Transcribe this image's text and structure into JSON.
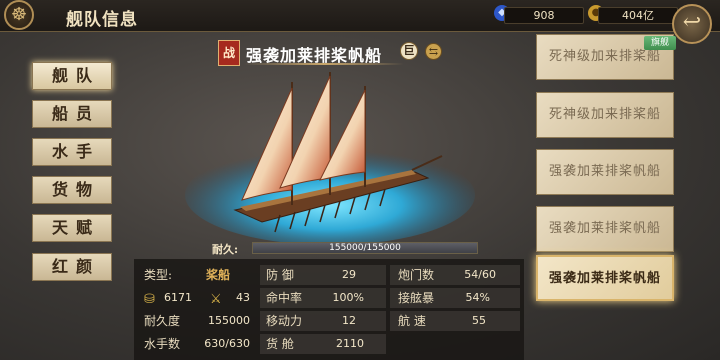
{
  "header": {
    "menu_icon": "compass-wheel-icon",
    "title": "舰队信息",
    "gems": "908",
    "gold": "404亿",
    "gem_icon": "blue-gem-icon",
    "coin_icon": "gold-coin-icon",
    "back_icon": "back-arrow-icon"
  },
  "sidebar": {
    "items": [
      {
        "label": "舰队",
        "active": true
      },
      {
        "label": "船员",
        "active": false
      },
      {
        "label": "水手",
        "active": false
      },
      {
        "label": "货物",
        "active": false
      },
      {
        "label": "天赋",
        "active": false
      },
      {
        "label": "红颜",
        "active": false
      }
    ]
  },
  "ship": {
    "battle_badge": "战",
    "name": "强袭加莱排桨帆船",
    "size_badge": "巨",
    "durability_label": "耐久:",
    "durability_text": "155000/155000",
    "durability_fraction": 1.0
  },
  "stats": {
    "type_label": "类型:",
    "type_value": "桨船",
    "food_value": "6171",
    "soldier_value": "43",
    "durability_label": "耐久度",
    "durability_value": "155000",
    "sailors_label": "水手数",
    "sailors_value": "630/630",
    "defense_label": "防  御",
    "defense_value": "29",
    "accuracy_label": "命中率",
    "accuracy_value": "100%",
    "mobility_label": "移动力",
    "mobility_value": "12",
    "cargo_label": "货  舱",
    "cargo_value": "2110",
    "cannon_label": "炮门数",
    "cannon_value": "54/60",
    "boarding_label": "接舷暴",
    "boarding_value": "54%",
    "speed_label": "航  速",
    "speed_value": "55"
  },
  "fleet_list": {
    "flagship_tag": "旗舰",
    "ships": [
      {
        "name": "死神级加来排桨船",
        "selected": false
      },
      {
        "name": "死神级加来排桨船",
        "selected": false
      },
      {
        "name": "强袭加莱排桨帆船",
        "selected": false
      },
      {
        "name": "强袭加莱排桨帆船",
        "selected": false
      },
      {
        "name": "强袭加莱排桨帆船",
        "selected": true
      }
    ]
  }
}
